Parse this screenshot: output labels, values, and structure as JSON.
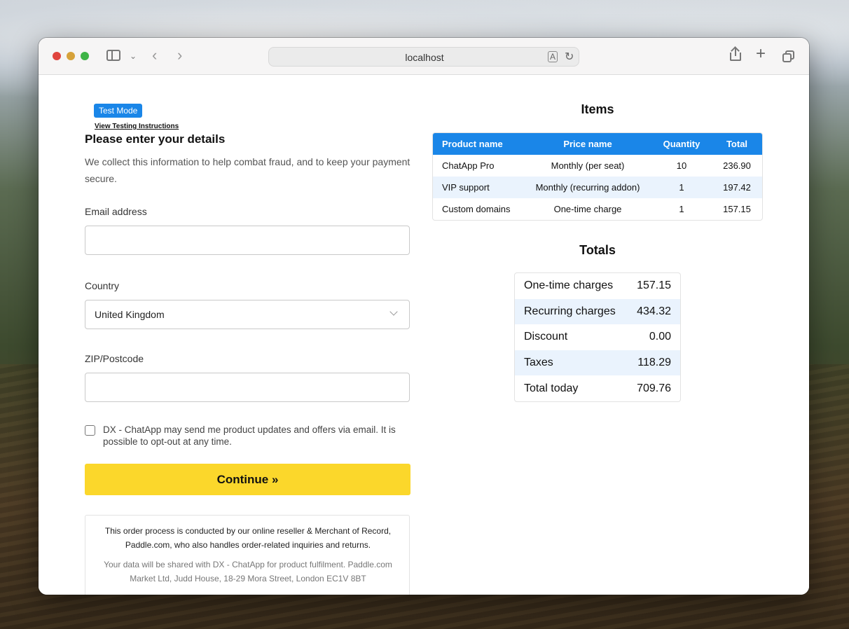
{
  "browser": {
    "url": "localhost"
  },
  "checkout": {
    "test_mode_badge": "Test Mode",
    "testing_link": "View Testing Instructions",
    "heading": "Please enter your details",
    "description": "We collect this information to help combat fraud, and to keep your payment secure.",
    "email_label": "Email address",
    "email_value": "",
    "country_label": "Country",
    "country_value": "United Kingdom",
    "zip_label": "ZIP/Postcode",
    "zip_value": "",
    "marketing_consent": "DX - ChatApp may send me product updates and offers via email. It is possible to opt-out at any time.",
    "marketing_checked": false,
    "continue_label": "Continue »",
    "reseller_notice": "This order process is conducted by our online reseller & Merchant of Record, Paddle.com, who also handles order-related inquiries and returns.",
    "data_notice": "Your data will be shared with DX - ChatApp for product fulfilment. Paddle.com Market Ltd, Judd House, 18-29 Mora Street, London EC1V 8BT"
  },
  "items": {
    "heading": "Items",
    "columns": [
      "Product name",
      "Price name",
      "Quantity",
      "Total"
    ],
    "rows": [
      [
        "ChatApp Pro",
        "Monthly (per seat)",
        "10",
        "236.90"
      ],
      [
        "VIP support",
        "Monthly (recurring addon)",
        "1",
        "197.42"
      ],
      [
        "Custom domains",
        "One-time charge",
        "1",
        "157.15"
      ]
    ]
  },
  "totals": {
    "heading": "Totals",
    "rows": [
      [
        "One-time charges",
        "157.15"
      ],
      [
        "Recurring charges",
        "434.32"
      ],
      [
        "Discount",
        "0.00"
      ],
      [
        "Taxes",
        "118.29"
      ],
      [
        "Total today",
        "709.76"
      ]
    ]
  },
  "colors": {
    "accent_blue": "#1a86e8",
    "row_alt": "#eaf3fd",
    "continue_yellow": "#fbd72b"
  }
}
